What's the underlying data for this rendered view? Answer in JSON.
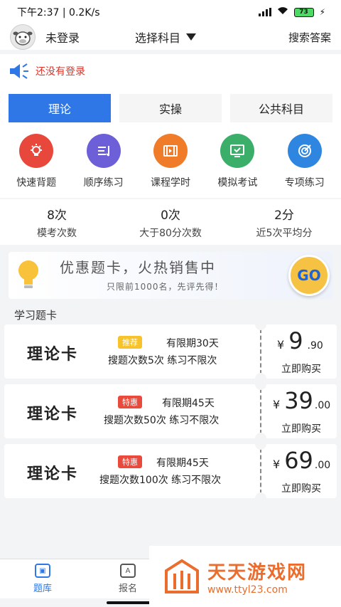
{
  "status_bar": {
    "time": "下午2:37 | 0.2K/s",
    "battery": "73"
  },
  "header": {
    "login_status": "未登录",
    "subject_select": "选择科目",
    "search_answer": "搜索答案"
  },
  "notice": {
    "text": "还没有登录"
  },
  "tabs": [
    {
      "label": "理论",
      "active": true
    },
    {
      "label": "实操",
      "active": false
    },
    {
      "label": "公共科目",
      "active": false
    }
  ],
  "features": [
    {
      "label": "快速背题",
      "icon": "bulb-icon",
      "color": "#e8473b"
    },
    {
      "label": "顺序练习",
      "icon": "list-order-icon",
      "color": "#6c5fd8"
    },
    {
      "label": "课程学时",
      "icon": "film-icon",
      "color": "#f07c2a"
    },
    {
      "label": "模拟考试",
      "icon": "monitor-check-icon",
      "color": "#3bae6a"
    },
    {
      "label": "专项练习",
      "icon": "target-icon",
      "color": "#2f86e0"
    }
  ],
  "stats": [
    {
      "value": "8次",
      "label": "模考次数"
    },
    {
      "value": "0次",
      "label": "大于80分次数"
    },
    {
      "value": "2分",
      "label": "近5次平均分"
    }
  ],
  "promo": {
    "title": "优惠题卡，火热销售中",
    "subtitle": "只限前1000名，先评先得！",
    "go": "GO"
  },
  "section_title": "学习题卡",
  "cards": [
    {
      "name": "理论卡",
      "badge": "推荐",
      "badge_type": "rec",
      "validity": "有限期30天",
      "limits": "搜题次数5次  练习不限次",
      "currency": "¥",
      "price_int": "9",
      "price_dec": ".90",
      "buy": "立即购买"
    },
    {
      "name": "理论卡",
      "badge": "特惠",
      "badge_type": "sale",
      "validity": "有限期45天",
      "limits": "搜题次数50次  练习不限次",
      "currency": "¥",
      "price_int": "39",
      "price_dec": ".00",
      "buy": "立即购买"
    },
    {
      "name": "理论卡",
      "badge": "特惠",
      "badge_type": "sale",
      "validity": "有限期45天",
      "limits": "搜题次数100次  练习不限次",
      "currency": "¥",
      "price_int": "69",
      "price_dec": ".00",
      "buy": "立即购买"
    }
  ],
  "bottom_nav": [
    {
      "label": "题库",
      "active": true
    },
    {
      "label": "报名",
      "active": false
    }
  ],
  "watermark": {
    "name": "天天游戏网",
    "url": "www.ttyl23.com"
  },
  "colors": {
    "primary": "#2f77e6",
    "alert": "#d9342b",
    "promo_go": "#f6c244"
  }
}
